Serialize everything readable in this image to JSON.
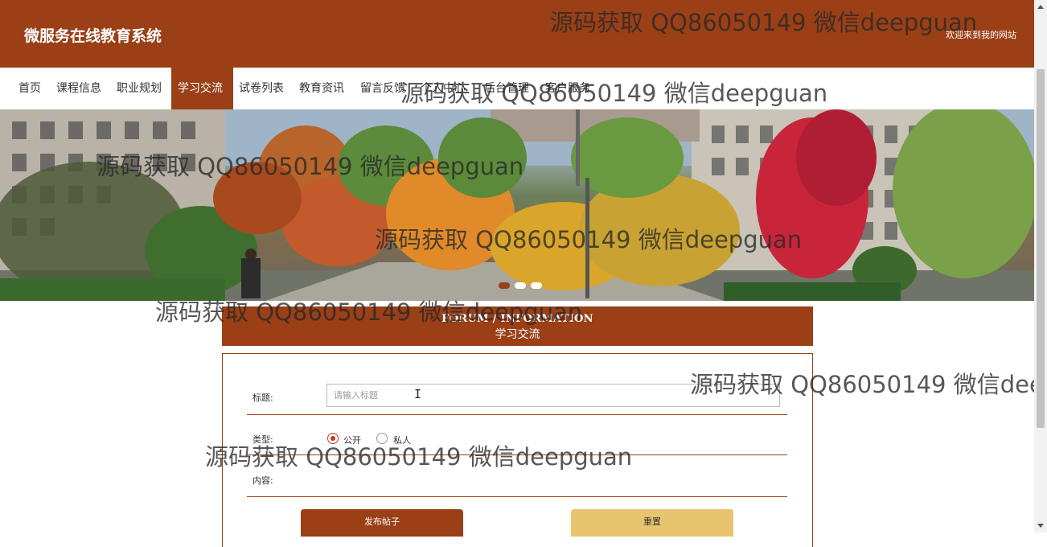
{
  "header": {
    "site_title": "微服务在线教育系统",
    "welcome_text": "欢迎来到我的网站"
  },
  "nav": {
    "items": [
      {
        "label": "首页"
      },
      {
        "label": "课程信息"
      },
      {
        "label": "职业规划"
      },
      {
        "label": "学习交流"
      },
      {
        "label": "试卷列表"
      },
      {
        "label": "教育资讯"
      },
      {
        "label": "留言反馈"
      },
      {
        "label": "个人中心"
      },
      {
        "label": "后台管理"
      },
      {
        "label": "客户服务"
      }
    ],
    "active_index": 3
  },
  "banner": {
    "slide_count": 3,
    "active_slide_index": 0
  },
  "section": {
    "title_en": "FORUM / INFORMATION",
    "title_zh": "学习交流"
  },
  "form": {
    "title_label": "标题:",
    "title_placeholder": "请输入标题",
    "title_value": "",
    "type_label": "类型:",
    "type_options": [
      {
        "label": "公开",
        "checked": true
      },
      {
        "label": "私人",
        "checked": false
      }
    ],
    "content_label": "内容:",
    "submit_label": "发布帖子",
    "reset_label": "重置"
  },
  "watermark": {
    "text": "源码获取 QQ86050149 微信deepguan",
    "text_truncated": "源码获取 QQ86050149 微信dee"
  },
  "colors": {
    "brand": "#9a3f16",
    "secondary_button": "#e8c46e",
    "radio_checked": "#c0392b"
  }
}
